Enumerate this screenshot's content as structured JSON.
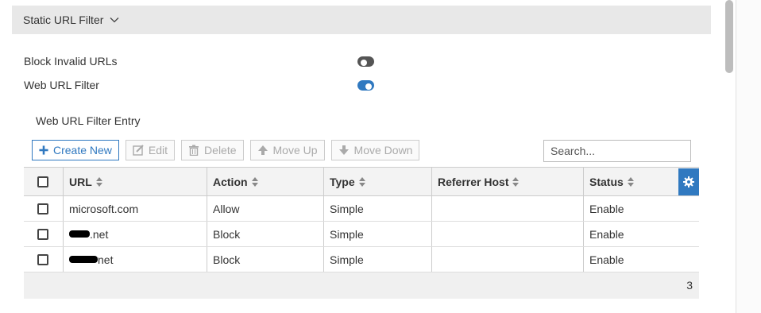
{
  "section": {
    "title": "Static URL Filter"
  },
  "settings": [
    {
      "label": "Block Invalid URLs",
      "enabled": false
    },
    {
      "label": "Web URL Filter",
      "enabled": true
    }
  ],
  "entry": {
    "heading": "Web URL Filter Entry"
  },
  "toolbar": {
    "create_new": "Create New",
    "edit": "Edit",
    "delete": "Delete",
    "move_up": "Move Up",
    "move_down": "Move Down"
  },
  "search": {
    "placeholder": "Search..."
  },
  "table": {
    "columns": [
      "URL",
      "Action",
      "Type",
      "Referrer Host",
      "Status"
    ],
    "rows": [
      {
        "url": "microsoft.com",
        "action": "Allow",
        "type": "Simple",
        "referrer_host": "",
        "status": "Enable"
      },
      {
        "url": ".net",
        "action": "Block",
        "type": "Simple",
        "referrer_host": "",
        "status": "Enable"
      },
      {
        "url": "net",
        "action": "Block",
        "type": "Simple",
        "referrer_host": "",
        "status": "Enable"
      }
    ],
    "count": "3"
  },
  "colors": {
    "accent": "#3079c0",
    "header_bg": "#e8e8e8",
    "toggle_off": "#555555"
  },
  "icons": {
    "section_toggle": "chevron-down-icon",
    "create": "plus-icon",
    "edit": "edit-icon",
    "delete": "trash-icon",
    "move_up": "arrow-up-icon",
    "move_down": "arrow-down-icon",
    "sort": "sort-icon",
    "settings": "gear-icon"
  }
}
